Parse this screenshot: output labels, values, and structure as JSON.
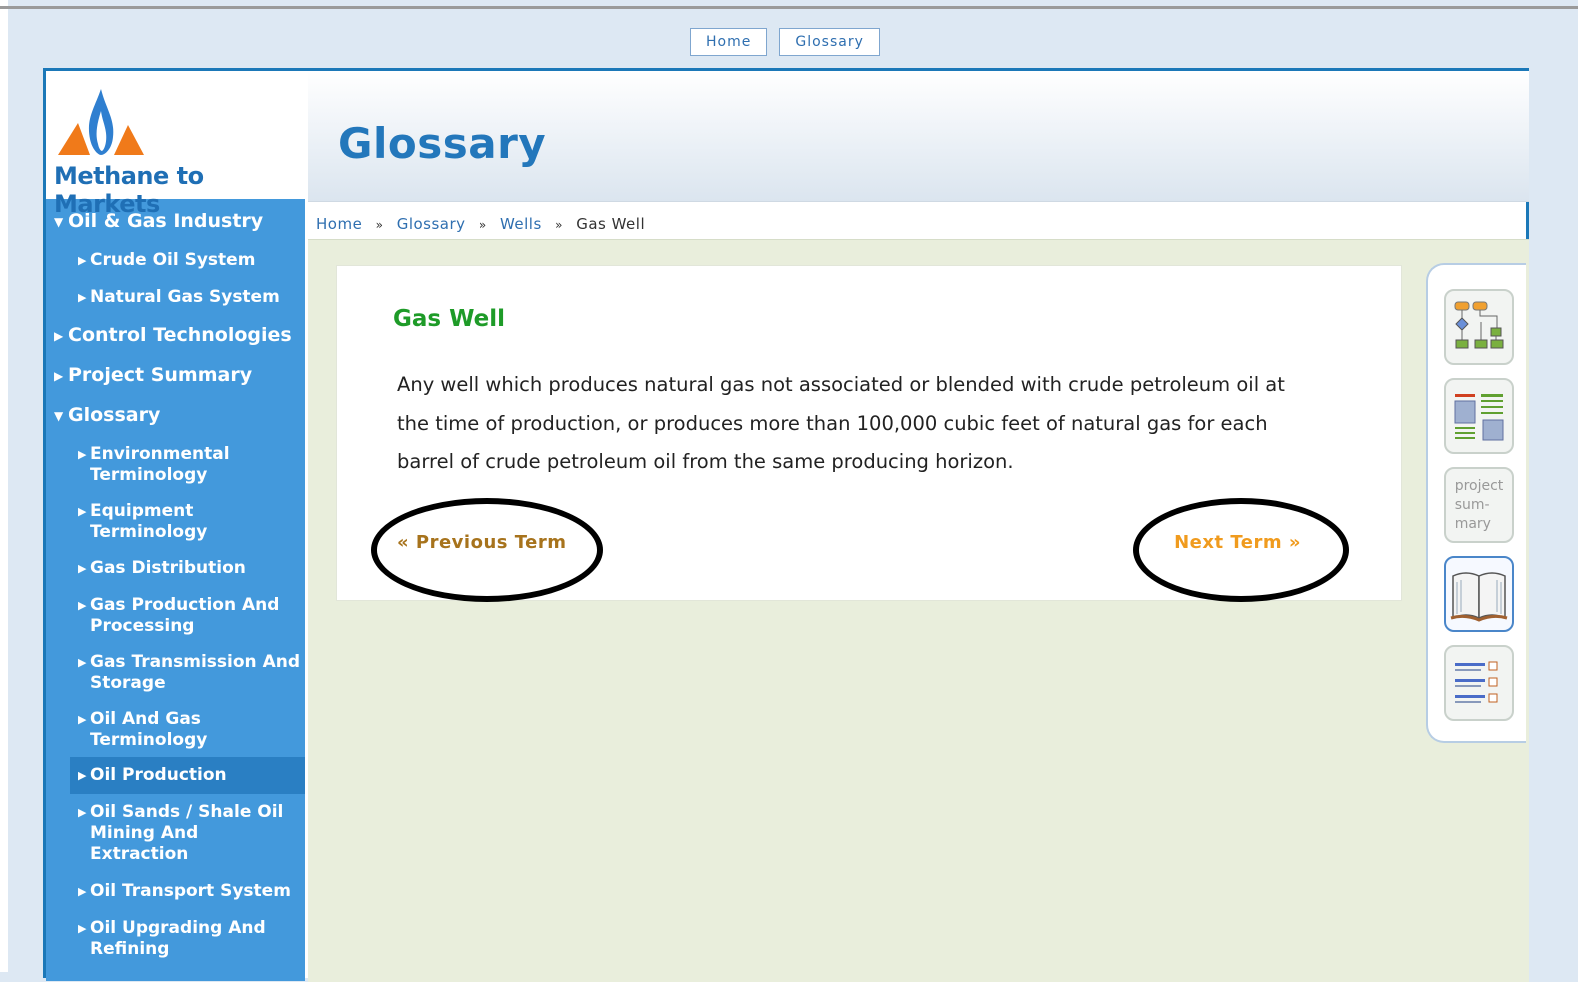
{
  "top_nav": {
    "home": "Home",
    "glossary": "Glossary"
  },
  "logo": {
    "text": "Methane to Markets"
  },
  "sidebar": {
    "items": [
      {
        "label": "Oil & Gas Industry",
        "level": 1,
        "expanded": true
      },
      {
        "label": "Crude Oil System",
        "level": 2
      },
      {
        "label": "Natural Gas System",
        "level": 2
      },
      {
        "label": "Control Technologies",
        "level": 1
      },
      {
        "label": "Project Summary",
        "level": 1
      },
      {
        "label": "Glossary",
        "level": 1,
        "expanded": true
      },
      {
        "label": "Environmental Terminology",
        "level": 2
      },
      {
        "label": "Equipment Terminology",
        "level": 2
      },
      {
        "label": "Gas Distribution",
        "level": 2
      },
      {
        "label": "Gas Production And Processing",
        "level": 2
      },
      {
        "label": "Gas Transmission And Storage",
        "level": 2
      },
      {
        "label": "Oil And Gas Terminology",
        "level": 2
      },
      {
        "label": "Oil Production",
        "level": 2,
        "active": true
      },
      {
        "label": "Oil Sands / Shale Oil Mining And Extraction",
        "level": 2
      },
      {
        "label": "Oil Transport System",
        "level": 2
      },
      {
        "label": "Oil Upgrading And Refining",
        "level": 2
      }
    ]
  },
  "header": {
    "title": "Glossary"
  },
  "breadcrumb": {
    "home": "Home",
    "glossary": "Glossary",
    "wells": "Wells",
    "current": "Gas Well"
  },
  "term": {
    "title": "Gas Well",
    "definition": "Any well which produces natural gas not associated or blended with crude petroleum oil at the time of production, or produces more than 100,000 cubic feet of natural gas for each barrel of crude petroleum oil from the same producing horizon.",
    "prev_label": "« Previous Term",
    "next_label": "Next Term »"
  },
  "toolbox": {
    "tools": [
      {
        "icon": "flowchart-icon"
      },
      {
        "icon": "document-layout-icon"
      },
      {
        "label": "project sum- mary"
      },
      {
        "icon": "book-icon",
        "selected": true
      },
      {
        "icon": "links-list-icon"
      }
    ],
    "project_summary_lines": [
      "project",
      "sum-",
      "mary"
    ]
  },
  "colors": {
    "frame": "#1b78b8",
    "sidebar": "#4399dc",
    "title_blue": "#2377bb",
    "term_green": "#1e9b28",
    "prev_link": "#a7731c",
    "next_link": "#f09b1e"
  }
}
